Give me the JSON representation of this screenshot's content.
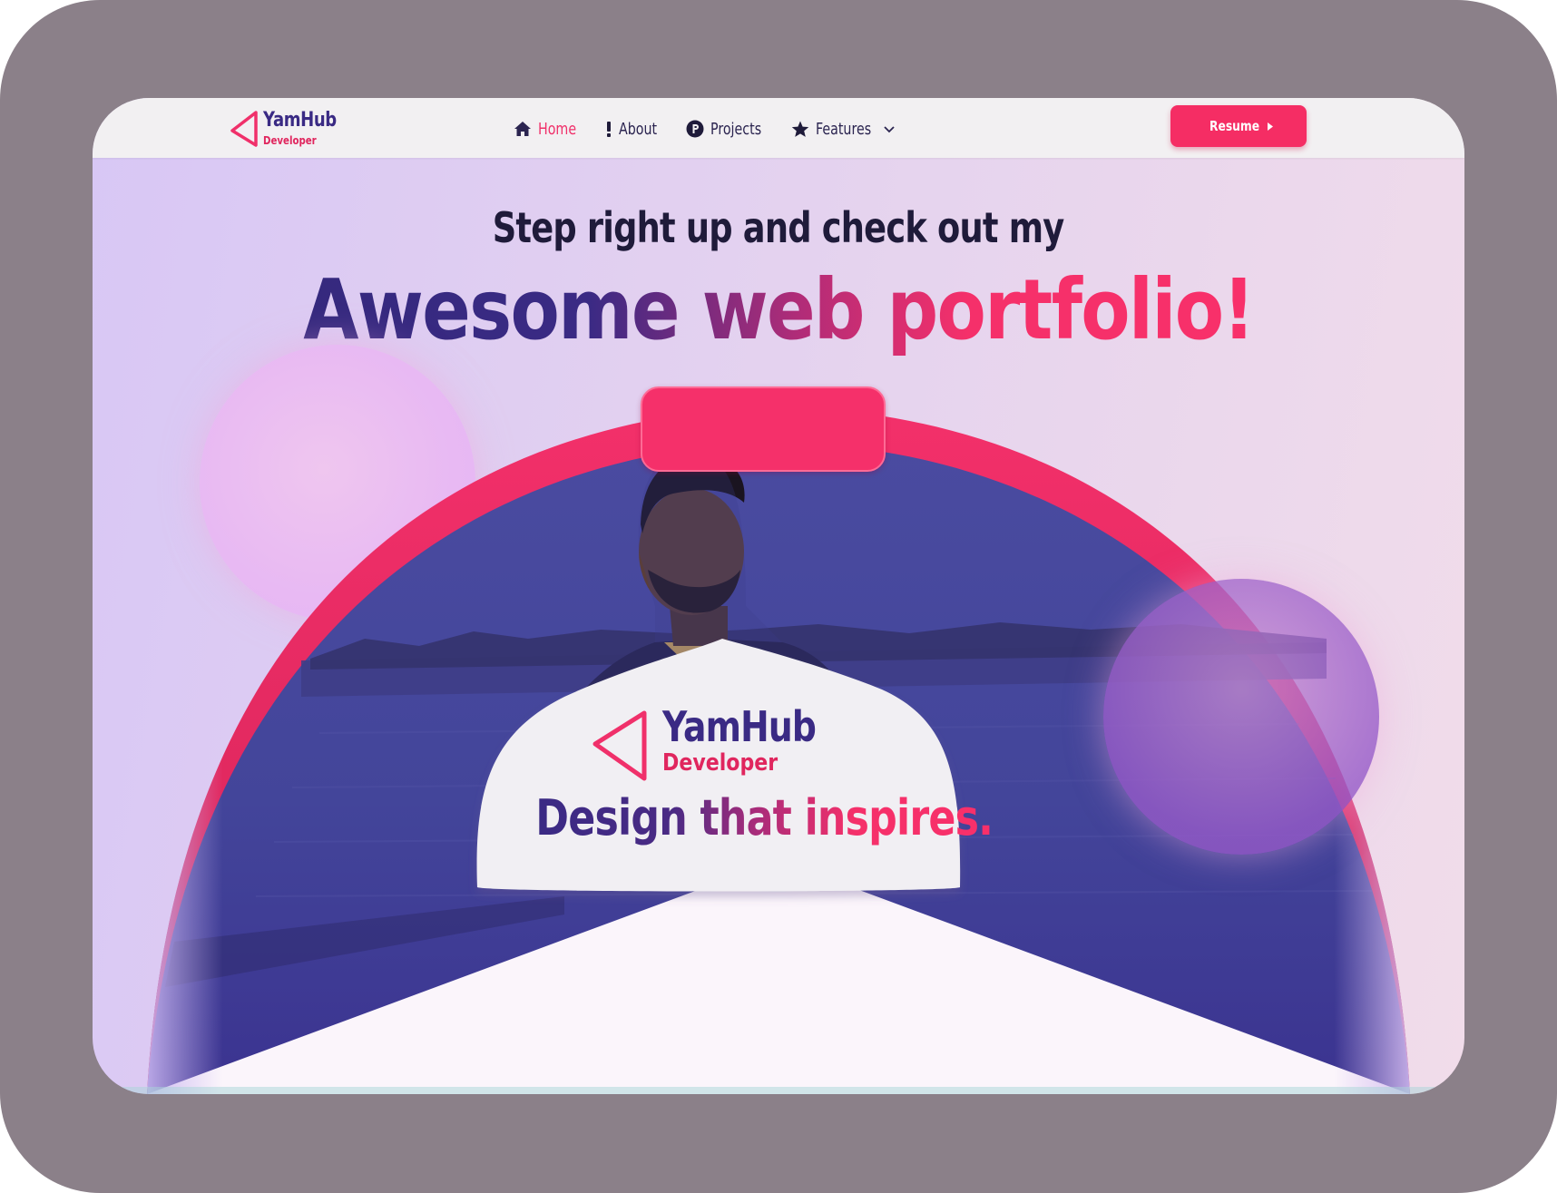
{
  "navbar": {
    "logo": {
      "name": "YamHub",
      "role": "Developer"
    },
    "items": [
      {
        "label": "Home",
        "icon": "home-icon",
        "active": true
      },
      {
        "label": "About",
        "icon": "exclamation-icon",
        "active": false
      },
      {
        "label": "Projects",
        "icon": "p-circle-icon",
        "active": false
      },
      {
        "label": "Features",
        "icon": "star-icon",
        "active": false,
        "dropdown": true
      }
    ],
    "resume_label": "Resume"
  },
  "hero": {
    "subtitle": "Step right up and check out my",
    "title": "Awesome web portfolio!",
    "card": {
      "logo": {
        "name": "YamHub",
        "role": "Developer"
      },
      "tagline": "Design that inspires."
    }
  },
  "colors": {
    "accent": "#f5306a",
    "brand": "#3a2a84",
    "frame": "#8b8089"
  }
}
